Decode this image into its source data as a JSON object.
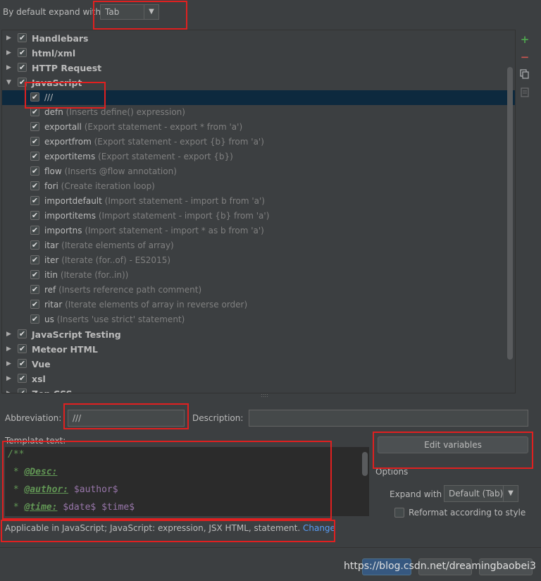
{
  "top": {
    "label": "By default expand with",
    "expand_value": "Tab"
  },
  "tree": {
    "rows": [
      {
        "type": "group",
        "expanded": false,
        "checked": true,
        "name": "Handlebars",
        "desc": ""
      },
      {
        "type": "group",
        "expanded": false,
        "checked": true,
        "name": "html/xml",
        "desc": ""
      },
      {
        "type": "group",
        "expanded": false,
        "checked": true,
        "name": "HTTP Request",
        "desc": ""
      },
      {
        "type": "group",
        "expanded": true,
        "checked": true,
        "name": "JavaScript",
        "desc": ""
      },
      {
        "type": "item",
        "checked": true,
        "selected": true,
        "name": "///",
        "desc": ""
      },
      {
        "type": "item",
        "checked": true,
        "name": "defn",
        "desc": "(Inserts define() expression)"
      },
      {
        "type": "item",
        "checked": true,
        "name": "exportall",
        "desc": "(Export statement - export * from 'a')"
      },
      {
        "type": "item",
        "checked": true,
        "name": "exportfrom",
        "desc": "(Export statement - export {b} from 'a')"
      },
      {
        "type": "item",
        "checked": true,
        "name": "exportitems",
        "desc": "(Export statement - export {b})"
      },
      {
        "type": "item",
        "checked": true,
        "name": "flow",
        "desc": "(Inserts @flow annotation)"
      },
      {
        "type": "item",
        "checked": true,
        "name": "fori",
        "desc": "(Create iteration loop)"
      },
      {
        "type": "item",
        "checked": true,
        "name": "importdefault",
        "desc": "(Import statement - import b from 'a')"
      },
      {
        "type": "item",
        "checked": true,
        "name": "importitems",
        "desc": "(Import statement - import {b} from 'a')"
      },
      {
        "type": "item",
        "checked": true,
        "name": "importns",
        "desc": "(Import statement - import * as b from 'a')"
      },
      {
        "type": "item",
        "checked": true,
        "name": "itar",
        "desc": "(Iterate elements of array)"
      },
      {
        "type": "item",
        "checked": true,
        "name": "iter",
        "desc": "(Iterate (for..of) - ES2015)"
      },
      {
        "type": "item",
        "checked": true,
        "name": "itin",
        "desc": "(Iterate (for..in))"
      },
      {
        "type": "item",
        "checked": true,
        "name": "ref",
        "desc": "(Inserts reference path comment)"
      },
      {
        "type": "item",
        "checked": true,
        "name": "ritar",
        "desc": "(Iterate elements of array in reverse order)"
      },
      {
        "type": "item",
        "checked": true,
        "name": "us",
        "desc": "(Inserts 'use strict' statement)"
      },
      {
        "type": "group",
        "expanded": false,
        "checked": true,
        "name": "JavaScript Testing",
        "desc": ""
      },
      {
        "type": "group",
        "expanded": false,
        "checked": true,
        "name": "Meteor HTML",
        "desc": ""
      },
      {
        "type": "group",
        "expanded": false,
        "checked": true,
        "name": "Vue",
        "desc": ""
      },
      {
        "type": "group",
        "expanded": false,
        "checked": true,
        "name": "xsl",
        "desc": ""
      },
      {
        "type": "group",
        "expanded": false,
        "checked": true,
        "name": "Zen CSS",
        "desc": ""
      }
    ]
  },
  "tools": {
    "add_icon": "+",
    "remove_icon": "−",
    "copy_icon": "copy-icon",
    "restore_icon": "restore-icon"
  },
  "abbreviation": {
    "label": "Abbreviation:",
    "value": "///"
  },
  "description": {
    "label": "Description:",
    "value": ""
  },
  "template": {
    "label": "Template text:",
    "line1": "/**",
    "line2_prefix": " * ",
    "line2_tag": "@Desc:",
    "line3_prefix": " * ",
    "line3_tag": "@author:",
    "line3_var": " $author$",
    "line4_prefix": " * ",
    "line4_tag": "@time:",
    "line4_var": " $date$ $time$"
  },
  "applicable": {
    "text": "Applicable in JavaScript; JavaScript: expression, JSX HTML, statement.",
    "link": "Change"
  },
  "right_panel": {
    "edit_variables": "Edit variables",
    "options_label": "Options",
    "expand_with_label": "Expand with",
    "expand_with_value": "Default (Tab)",
    "reformat_label": "Reformat according to style"
  },
  "watermark": "https://blog.csdn.net/dreamingbaobei3"
}
